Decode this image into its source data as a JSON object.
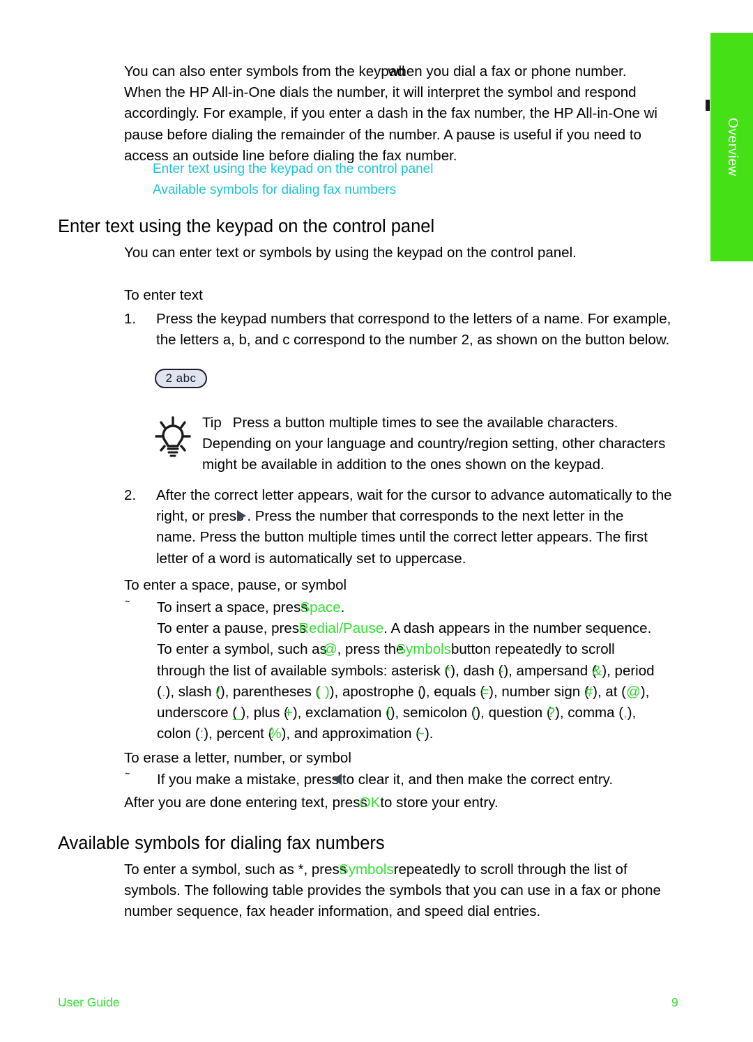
{
  "side_tab": {
    "label": "Overview",
    "color": "#45e016",
    "text_color": "#ffffff"
  },
  "colors": {
    "link": "#1cc4d6",
    "button_name": "#33e033",
    "symbol": "#2fd32f",
    "tab_green": "#45e016",
    "keycap_fill": "#dfe4ef",
    "keycap_border": "#1b1b2b",
    "arrow": "#3c4656"
  },
  "intro": {
    "line1_a": "You can also enter symbols from the keypad",
    "line1_b": "when you dial a fax or phone number.",
    "line2": "When the HP All-in-One dials the number, it will interpret the symbol and respond",
    "line3": "accordingly. For example, if you enter a dash in the fax number, the HP All-in-One wi",
    "line4": "pause before dialing the remainder of the number. A pause is useful if you need to",
    "line5": "access an outside line before dialing the fax number."
  },
  "toc": {
    "items": [
      "Enter text using the keypad on the control panel",
      "Available symbols for dialing fax numbers"
    ]
  },
  "section_enter_text": {
    "heading": "Enter text using the keypad on the control panel",
    "intro": "You can enter text or symbols by using the keypad on the control panel.",
    "subhead_to_enter_text": "To enter text",
    "step1": {
      "number": "1.",
      "line1": "Press the keypad numbers that correspond to the letters of a name. For example,",
      "line2": "the letters a, b, and c correspond to the number 2, as shown on the button below."
    },
    "keycap_label": "2 abc",
    "tip": {
      "icon": "lightbulb-icon",
      "word": "Tip",
      "line1": "Press a button multiple times to see the available characters.",
      "line2": "Depending on your language and country/region setting, other characters",
      "line3": "might be available in addition to the ones shown on the keypad."
    },
    "step2": {
      "number": "2.",
      "line1": "After the correct letter appears, wait for the cursor to advance automatically to the",
      "line2_a": "right, or press",
      "line2_b": ". Press the number that corresponds to the next letter in the",
      "line3": "name. Press the button multiple times until the correct letter appears. The first",
      "line4": "letter of a word is automatically set to uppercase."
    },
    "subhead_space": "To enter a space, pause, or symbol",
    "bullet_marker": "˜",
    "space_block": {
      "line1_a": "To insert a space, press",
      "line1_btn": "Space",
      "line1_c": ".",
      "line2_a": "To enter a pause, press",
      "line2_btn": "Redial/Pause",
      "line2_c": ". A dash appears in the number sequence.",
      "line3_a": "To enter a symbol, such as",
      "line3_sym": "@",
      "line3_b": ", press the",
      "line3_btn": "Symbols",
      "line3_c": "button repeatedly to scroll",
      "line4_a": "through the list of available symbols: asterisk (",
      "line4_s1": "*",
      "line4_b": "), dash (",
      "line4_s2": "-",
      "line4_c": "), ampersand (",
      "line4_s3": "&",
      "line4_d": "), period",
      "line5_a": "(",
      "line5_s1": ".",
      "line5_b": "), slash (",
      "line5_s2": "/",
      "line5_c": "), parentheses (",
      "line5_s3": "( )",
      "line5_d": "), apostrophe (",
      "line5_s4": "'",
      "line5_e": "), equals (",
      "line5_s5": "=",
      "line5_f": "), number sign (",
      "line5_s6": "#",
      "line5_g": "), at (",
      "line5_s7": "@",
      "line5_h": "),",
      "line6_a": "underscore (",
      "line6_s1": "_",
      "line6_b": "), plus (",
      "line6_s2": "+",
      "line6_c": "), exclamation (",
      "line6_s3": "!",
      "line6_d": "), semicolon (",
      "line6_s4": ";",
      "line6_e": "), question (",
      "line6_s5": "?",
      "line6_f": "), comma (",
      "line6_s6": ",",
      "line6_g": "),",
      "line7_a": "colon (",
      "line7_s1": ":",
      "line7_b": "), percent (",
      "line7_s2": "%",
      "line7_c": "), and approximation (",
      "line7_s3": "~",
      "line7_d": ")."
    },
    "subhead_erase": "To erase a letter, number, or symbol",
    "erase_line_a": "If you make a mistake, press",
    "erase_line_b": "to clear it, and then make the correct entry.",
    "after_done_a": "After you are done entering text, press",
    "after_done_btn": "OK",
    "after_done_b": "to store your entry."
  },
  "section_available_symbols": {
    "heading": "Available symbols for dialing fax numbers",
    "line1_a": "To enter a symbol, such as *, press",
    "line1_btn": "Symbols",
    "line1_c": "repeatedly to scroll through the list of",
    "line2": "symbols. The following table provides the symbols that you can use in a fax or phone",
    "line3": "number sequence, fax header information, and speed dial entries."
  },
  "footer": {
    "left": "User Guide",
    "page_number": "9"
  }
}
